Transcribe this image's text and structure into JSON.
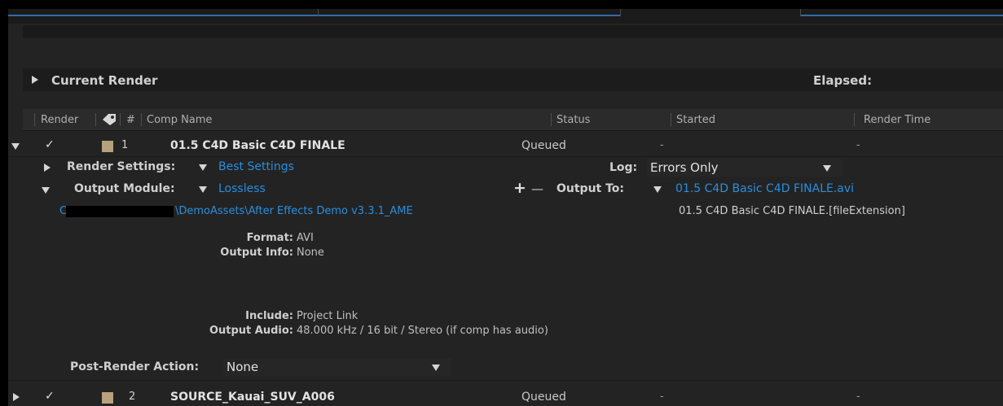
{
  "current_render": {
    "label": "Current Render",
    "elapsed_label": "Elapsed:"
  },
  "columns": {
    "render": "Render",
    "number": "#",
    "comp_name": "Comp Name",
    "status": "Status",
    "started": "Started",
    "render_time": "Render Time"
  },
  "items": [
    {
      "check": "✓",
      "number": "1",
      "comp_name": "01.5 C4D Basic C4D FINALE",
      "status": "Queued",
      "started": "-",
      "render_time": "-"
    },
    {
      "check": "✓",
      "number": "2",
      "comp_name": "SOURCE_Kauai_SUV_A006",
      "status": "Queued",
      "started": "-",
      "render_time": "-"
    }
  ],
  "render_settings": {
    "label": "Render Settings:",
    "value": "Best Settings",
    "log_label": "Log:",
    "log_value": "Errors Only"
  },
  "output_module": {
    "label": "Output Module:",
    "value": "Lossless",
    "plus": "+",
    "minus": "—",
    "output_to_label": "Output To:",
    "output_to_value": "01.5 C4D Basic C4D FINALE.avi",
    "output_to_template": "01.5 C4D Basic C4D FINALE.[fileExtension]",
    "path_start": "C",
    "path_visible": "\\DemoAssets\\After Effects Demo v3.3.1_AME",
    "format_label": "Format:",
    "format_value": "AVI",
    "output_info_label": "Output Info:",
    "output_info_value": "None",
    "include_label": "Include:",
    "include_value": "Project Link",
    "output_audio_label": "Output Audio:",
    "output_audio_value": "48.000 kHz / 16 bit / Stereo (if comp has audio)"
  },
  "post_render": {
    "label": "Post-Render Action:",
    "value": "None"
  },
  "colors": {
    "link": "#2a8edd",
    "label_swatch": "#b8a27c",
    "tab_accent": "#2f6da8"
  }
}
